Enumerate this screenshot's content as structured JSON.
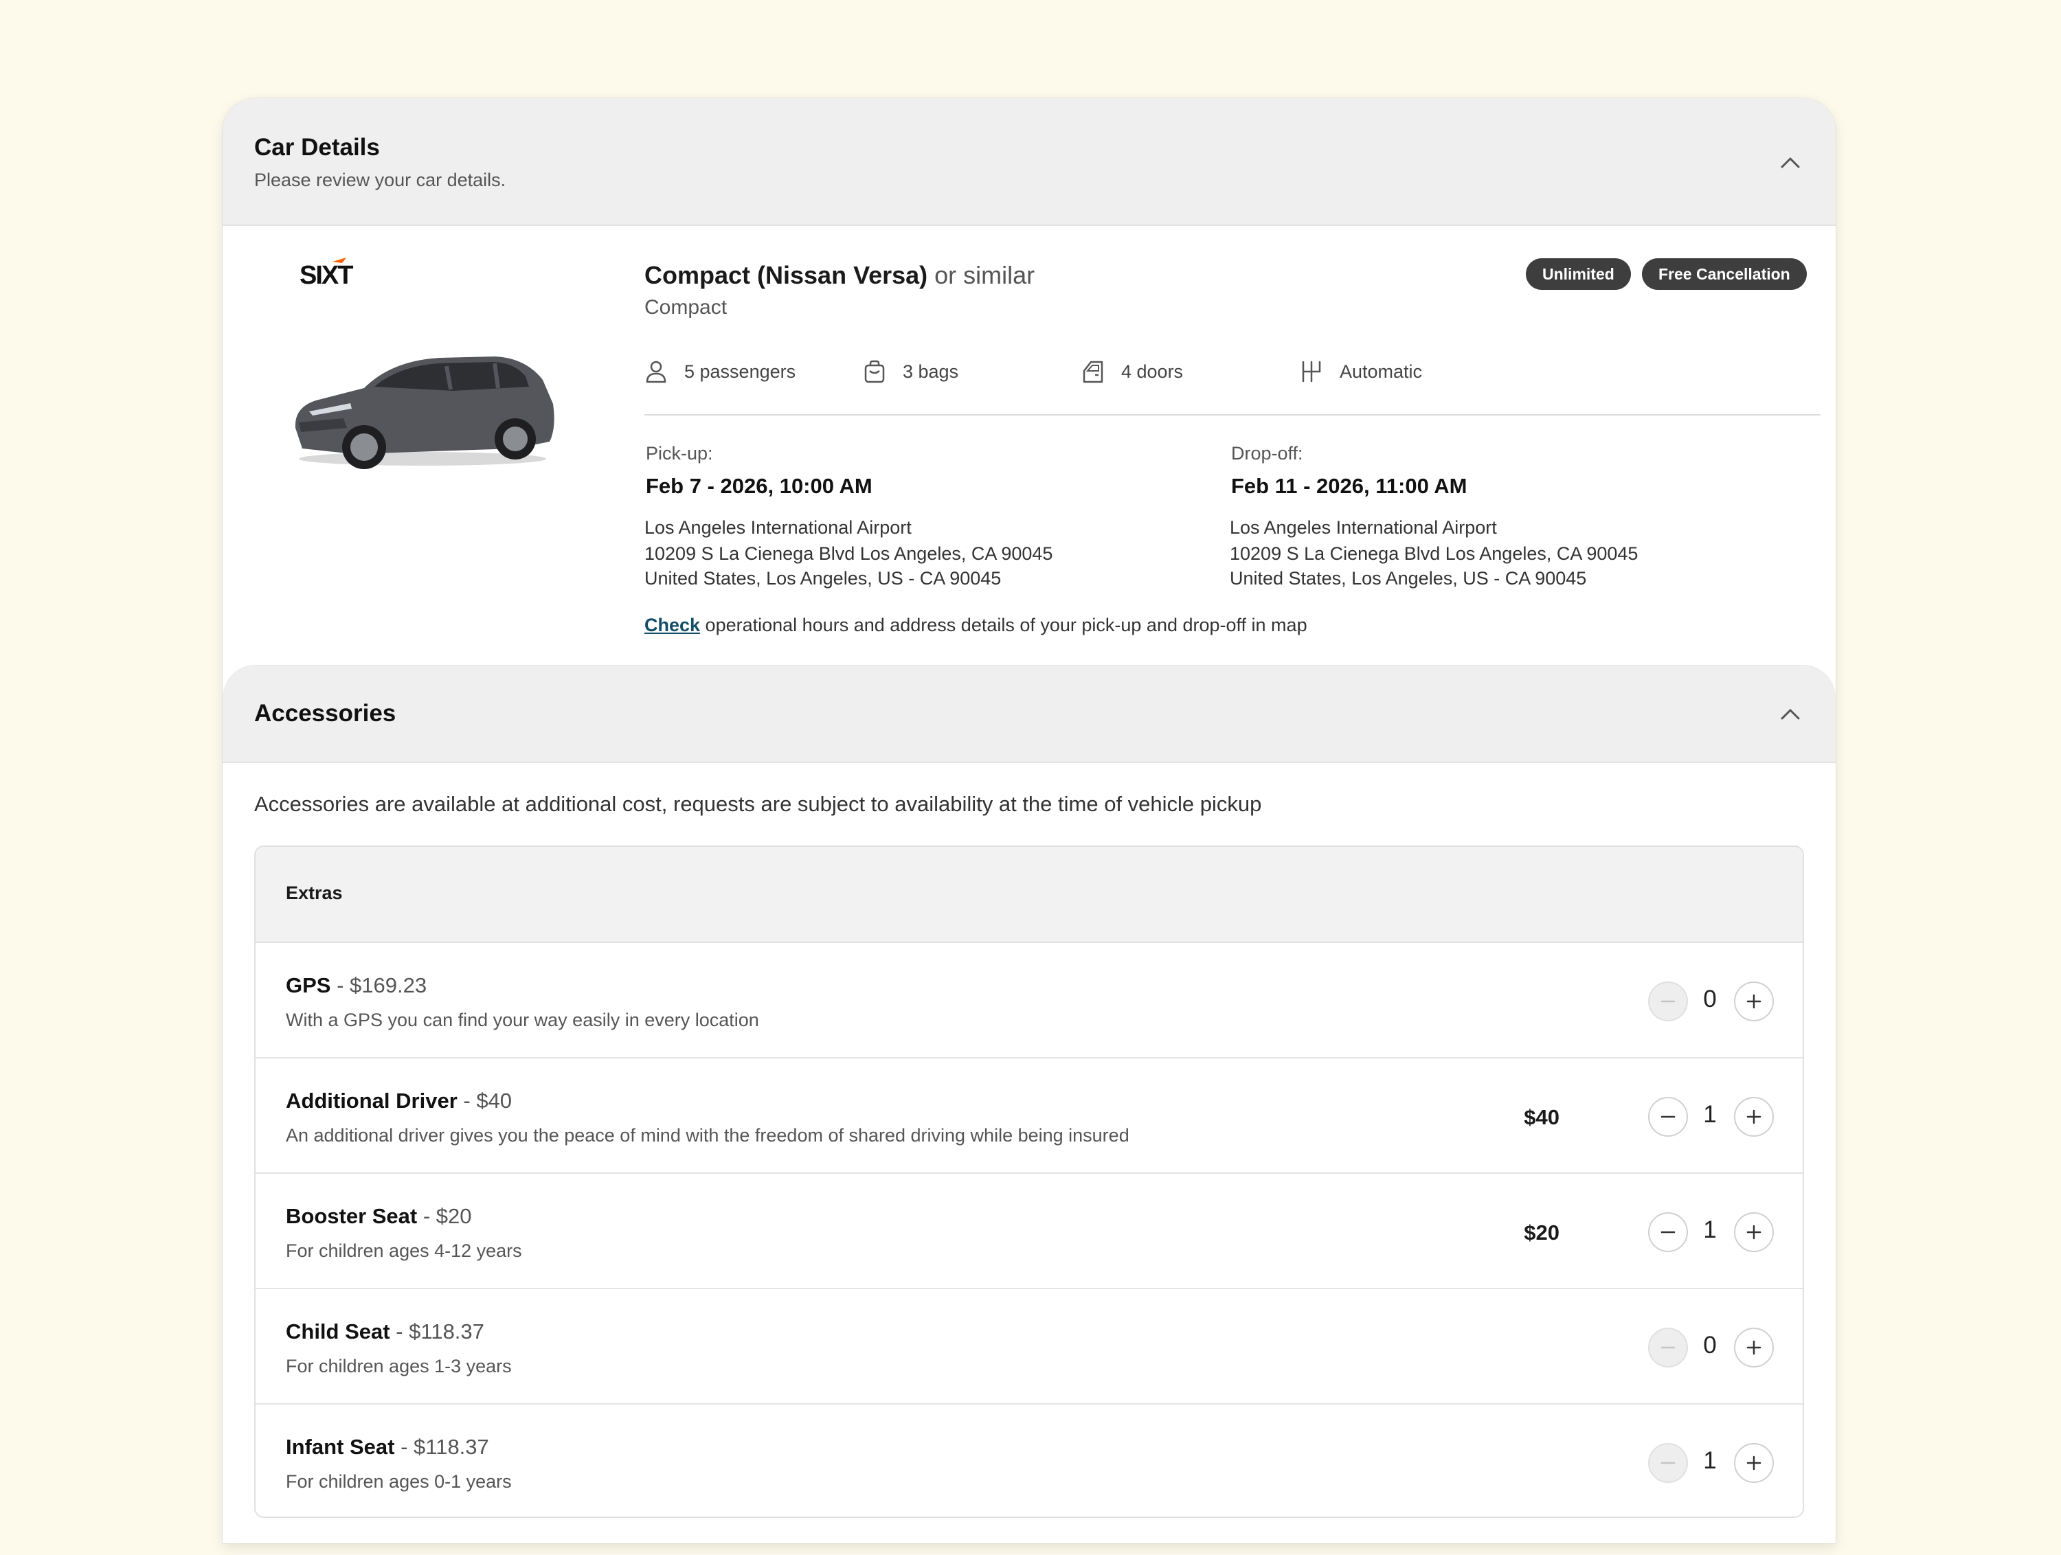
{
  "car_details": {
    "title": "Car Details",
    "subtitle": "Please review your car details.",
    "logo_text": "SIXT",
    "car_name": "Compact (Nissan Versa)",
    "car_similar": " or similar",
    "car_class": "Compact",
    "badges": [
      "Unlimited",
      "Free Cancellation"
    ],
    "features": {
      "passengers": "5 passengers",
      "bags": "3 bags",
      "doors": "4 doors",
      "transmission": "Automatic"
    },
    "pickup": {
      "label": "Pick-up:",
      "date": "Feb 7 - 2026, 10:00 AM",
      "location": "Los Angeles International Airport",
      "address1": "10209 S La Cienega Blvd Los Angeles, CA 90045",
      "address2": "United States, Los Angeles, US - CA 90045"
    },
    "dropoff": {
      "label": "Drop-off:",
      "date": "Feb 11 - 2026, 11:00 AM",
      "location": "Los Angeles International Airport",
      "address1": "10209 S La Cienega Blvd Los Angeles, CA 90045",
      "address2": "United States, Los Angeles, US - CA 90045"
    },
    "check_link": "Check",
    "check_text": " operational hours and address details of your pick-up and drop-off in map"
  },
  "accessories": {
    "title": "Accessories",
    "note": "Accessories are available at additional cost, requests are subject to availability at the time of vehicle pickup",
    "extras_title": "Extras",
    "items": [
      {
        "name": "GPS",
        "price": " - $169.23",
        "desc": "With a GPS you can find your way easily in every location",
        "total": "",
        "qty": "0",
        "minus_disabled": true
      },
      {
        "name": "Additional Driver",
        "price": " - $40",
        "desc": "An additional driver gives you the peace of mind with the freedom of shared driving while being insured",
        "total": "$40",
        "qty": "1",
        "minus_disabled": false
      },
      {
        "name": "Booster Seat",
        "price": " - $20",
        "desc": "For children ages 4-12 years",
        "total": "$20",
        "qty": "1",
        "minus_disabled": false
      },
      {
        "name": "Child Seat",
        "price": " - $118.37",
        "desc": "For children ages 1-3 years",
        "total": "",
        "qty": "0",
        "minus_disabled": true
      },
      {
        "name": "Infant Seat",
        "price": " - $118.37",
        "desc": "For children ages 0-1 years",
        "total": "",
        "qty": "1",
        "minus_disabled": true
      }
    ]
  },
  "colors": {
    "background": "#fdfaec",
    "header_bg": "#efefef",
    "badge_bg": "#3e3e3e",
    "link": "#124e66",
    "sixt_orange": "#ff5f00"
  }
}
